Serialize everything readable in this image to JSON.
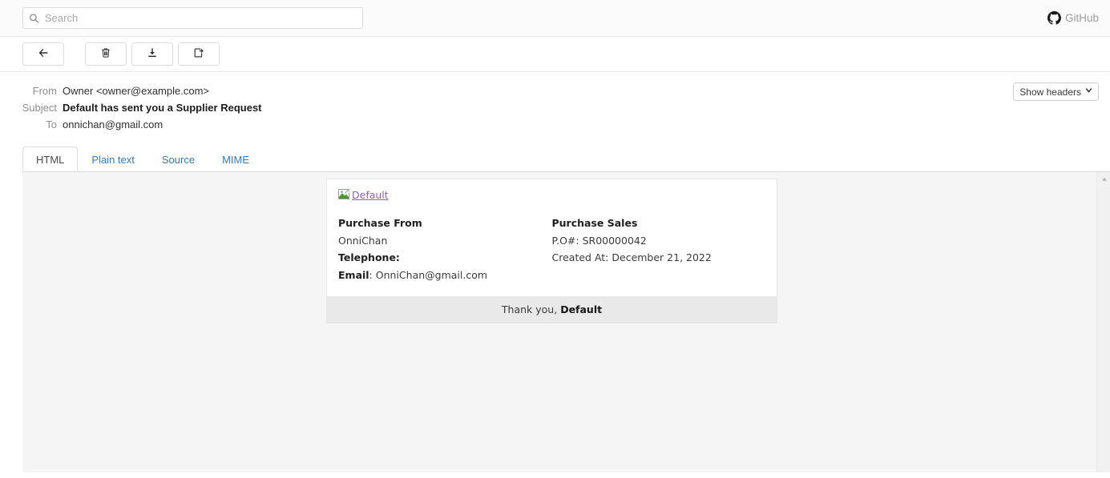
{
  "search": {
    "placeholder": "Search",
    "value": "",
    "icon": "search-icon"
  },
  "brand": {
    "label": "GitHub",
    "icon": "github-mark-icon",
    "color": "#9b9b9b"
  },
  "toolbar": {
    "buttons": [
      {
        "name": "back-button",
        "icon": "arrow-left-icon"
      },
      {
        "name": "delete-button",
        "icon": "trash-icon"
      },
      {
        "name": "download-button",
        "icon": "download-icon"
      },
      {
        "name": "release-button",
        "icon": "release-icon"
      }
    ]
  },
  "headers": {
    "rows": [
      {
        "label": "From",
        "value": "Owner <owner@example.com>",
        "bold": false
      },
      {
        "label": "Subject",
        "value": "Default has sent you a Supplier Request",
        "bold": true
      },
      {
        "label": "To",
        "value": "onnichan@gmail.com",
        "bold": false
      }
    ],
    "show_headers_label": "Show headers",
    "show_headers_caret": "✓"
  },
  "tabs": {
    "items": [
      {
        "label": "HTML",
        "active": true
      },
      {
        "label": "Plain text",
        "active": false
      },
      {
        "label": "Source",
        "active": false
      },
      {
        "label": "MIME",
        "active": false
      }
    ],
    "active_color": "#4c4c4c",
    "link_color": "#337ab7"
  },
  "mail": {
    "logo_alt": "Default",
    "left_column": {
      "heading": "Purchase From",
      "name": "OnniChan",
      "telephone_label": "Telephone:",
      "telephone_value": "",
      "email_label": "Email",
      "email_value": "OnniChan@gmail.com"
    },
    "right_column": {
      "heading": "Purchase Sales",
      "po_label": "P.O#:",
      "po_value": "SR00000042",
      "created_label": "Created At:",
      "created_value": "December 21, 2022"
    },
    "footer_prefix": "Thank you, ",
    "footer_name": "Default"
  },
  "scrollbar": {
    "up_arrow_icon": "scroll-up-arrow-icon"
  }
}
